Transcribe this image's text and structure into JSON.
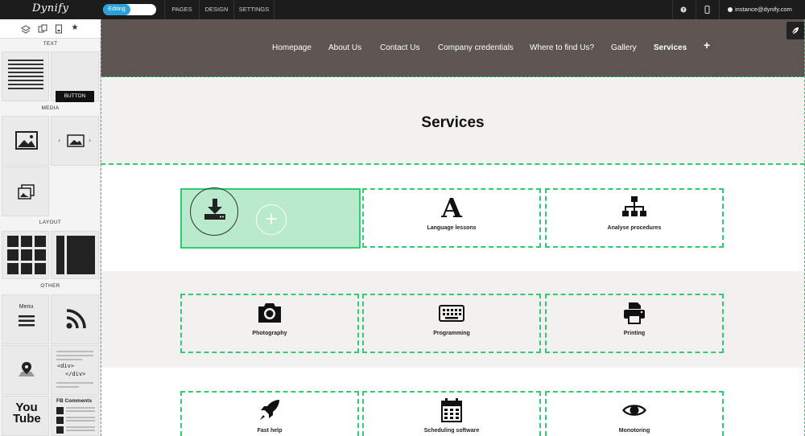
{
  "app": {
    "logo": "Dynify",
    "editing_label": "Editing",
    "nav": [
      "PAGES",
      "DESIGN",
      "SETTINGS"
    ],
    "help_icon": "question-circle-icon",
    "mobile_icon": "mobile-icon",
    "user_email": "instance@dynify.com",
    "accent": "#2d9fd8"
  },
  "sidebar": {
    "top_icons": [
      "layers-icon",
      "copy-icon",
      "page-icon",
      "star-icon"
    ],
    "sections": {
      "text": "TEXT",
      "media": "MEDIA",
      "layout": "LAYOUT",
      "other": "OTHER"
    },
    "button_tile_label": "BUTTON",
    "menu_tile_label": "Menu",
    "html_tile_lines": [
      "<div>",
      "</div>"
    ],
    "youtube_label": "You Tube",
    "fb_comments_label": "FB Comments"
  },
  "site": {
    "nav": [
      "Homepage",
      "About Us",
      "Contact Us",
      "Company credentials",
      "Where to find Us?",
      "Gallery",
      "Services"
    ],
    "active_nav": "Services",
    "add_page": "+",
    "title": "Services",
    "header_color": "#5c5552",
    "guide_color": "#2ecc71",
    "rows": [
      {
        "cells": [
          "",
          "Language lessons",
          "Analyse procedures"
        ]
      },
      {
        "cells": [
          "Photography",
          "Programming",
          "Printing"
        ]
      },
      {
        "cells": [
          "Fast help",
          "Scheduling software",
          "Monotoring"
        ]
      }
    ],
    "selected_cell_add": "+"
  }
}
